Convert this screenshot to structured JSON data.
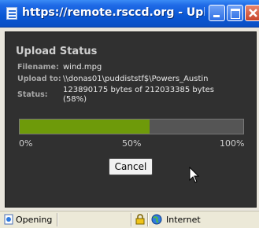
{
  "window": {
    "title": "https://remote.rsccd.org - Upload St..."
  },
  "upload": {
    "heading": "Upload Status",
    "filename_label": "Filename:",
    "filename_value": "wind.mpg",
    "upload_to_label": "Upload to:",
    "upload_to_value": "\\\\donas01\\puddiststf$\\Powers_Austin",
    "status_label": "Status:",
    "status_value_line1": "123890175 bytes of 212033385 bytes",
    "status_value_line2": "(58%)",
    "progress_fraction": 0.58,
    "scale_labels": [
      "0%",
      "50%",
      "100%"
    ],
    "cancel_label": "Cancel"
  },
  "statusbar": {
    "left_text": "Opening",
    "zone_text": "Internet"
  },
  "colors": {
    "panel_bg": "#303030",
    "progress_fill": "#6e9a0a",
    "progress_track": "#555555",
    "titlebar_blue": "#0a57d4"
  },
  "icons": {
    "title": "ie-page-icon",
    "minimize": "minimize-icon",
    "maximize": "maximize-icon",
    "close": "close-icon",
    "status_page": "page-icon",
    "lock": "lock-icon",
    "zone": "globe-icon",
    "cursor": "mouse-cursor-icon"
  }
}
